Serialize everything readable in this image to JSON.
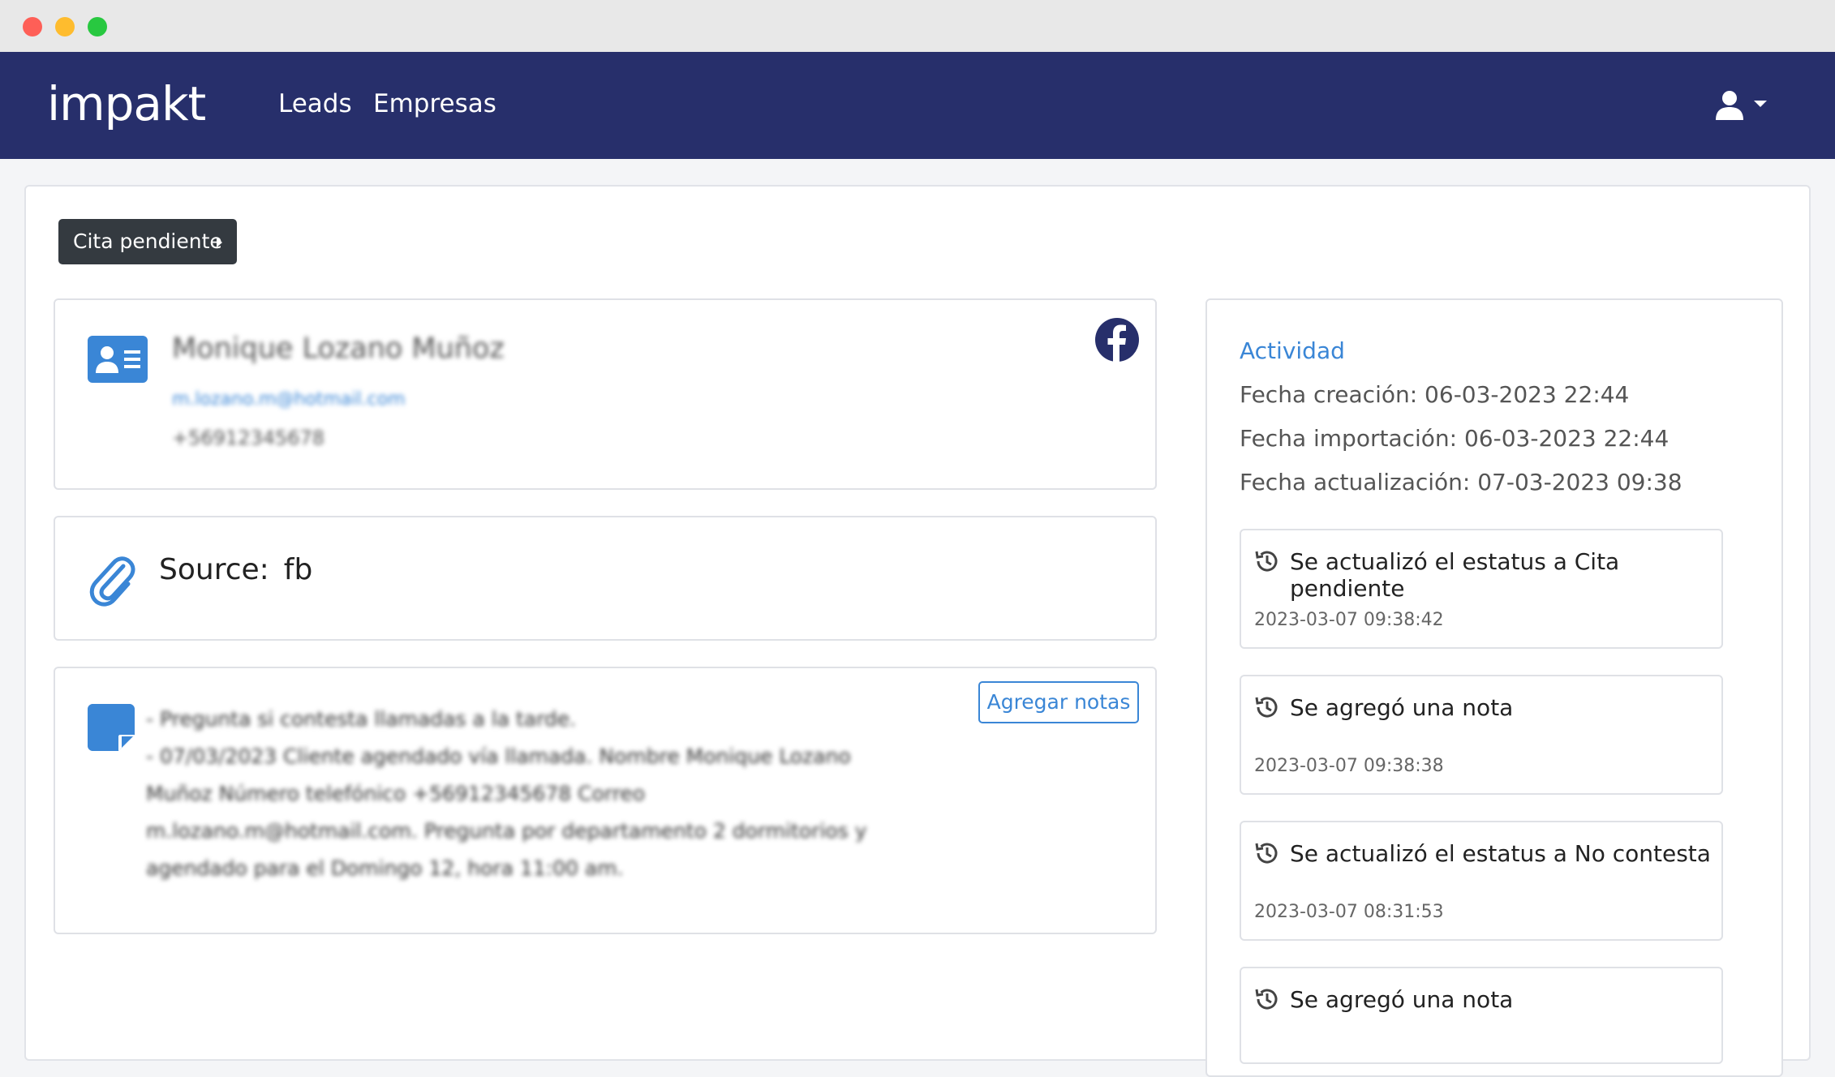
{
  "brand": {
    "logo_text": "impakt"
  },
  "nav": {
    "leads": "Leads",
    "empresas": "Empresas"
  },
  "status_button": {
    "label": "Cita pendiente"
  },
  "contact": {
    "name": "Monique Lozano Muñoz",
    "email": "m.lozano.m@hotmail.com",
    "phone": "+56912345678"
  },
  "source": {
    "label": "Source:",
    "value": "fb"
  },
  "notes": {
    "add_button": "Agregar notas",
    "lines": [
      "- Pregunta si contesta llamadas a la tarde.",
      "- 07/03/2023 Cliente agendado vía llamada. Nombre Monique Lozano",
      "Muñoz Número telefónico +56912345678 Correo",
      "m.lozano.m@hotmail.com. Pregunta por departamento 2 dormitorios y",
      "agendado para el Domingo 12, hora 11:00 am."
    ]
  },
  "activity": {
    "title": "Actividad",
    "created": "Fecha creación: 06-03-2023 22:44",
    "imported": "Fecha importación: 06-03-2023 22:44",
    "updated": "Fecha actualización: 07-03-2023 09:38",
    "events": [
      {
        "text": "Se actualizó el estatus a Cita pendiente",
        "time": "2023-03-07 09:38:42"
      },
      {
        "text": "Se agregó una nota",
        "time": "2023-03-07 09:38:38"
      },
      {
        "text": "Se actualizó el estatus a No contesta",
        "time": "2023-03-07 08:31:53"
      },
      {
        "text": "Se agregó una nota",
        "time": ""
      }
    ]
  },
  "colors": {
    "navbar": "#272f6b",
    "accent": "#3a86d6",
    "dark_button": "#343a40"
  }
}
